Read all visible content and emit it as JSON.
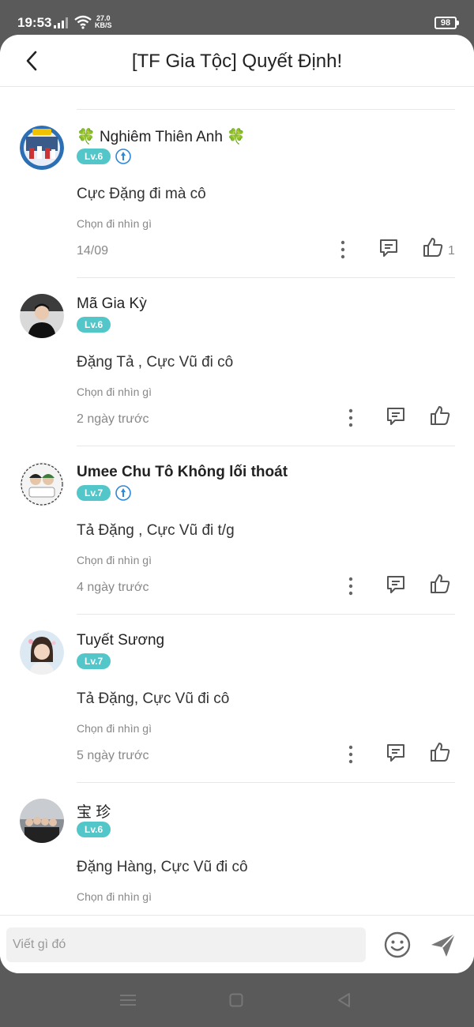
{
  "status_bar": {
    "time": "19:53",
    "net_speed_value": "27.0",
    "net_speed_unit": "KB/S",
    "battery": "98"
  },
  "header": {
    "title": "[TF Gia Tộc] Quyết Định!"
  },
  "colors": {
    "level_badge": "#52c6c9",
    "vip_badge": "#2f87d8",
    "text_primary": "#222222",
    "text_secondary": "#888888"
  },
  "comments": [
    {
      "name": "Nghiêm Thiên Anh",
      "name_prefix": "🍀",
      "name_suffix": "🍀",
      "level": "Lv.6",
      "has_vip": true,
      "text": "Cực Đặng đi mà cô",
      "option": "Chọn đi nhìn gì",
      "time": "14/09",
      "like_count": "1"
    },
    {
      "name": "Mã Gia Kỳ",
      "level": "Lv.6",
      "has_vip": false,
      "text": "Đặng Tả , Cực Vũ đi cô",
      "option": "Chọn đi nhìn gì",
      "time": "2 ngày trước",
      "like_count": ""
    },
    {
      "name": "Umee Chu Tô Không lối thoát",
      "level": "Lv.7",
      "has_vip": true,
      "text": "Tả Đặng , Cực Vũ đi t/g",
      "option": "Chọn đi nhìn gì",
      "time": "4 ngày trước",
      "like_count": ""
    },
    {
      "name": "Tuyết Sương",
      "level": "Lv.7",
      "has_vip": false,
      "text": "Tả Đặng, Cực Vũ đi cô",
      "option": "Chọn đi nhìn gì",
      "time": "5 ngày trước",
      "like_count": ""
    },
    {
      "name": "宝 珍",
      "level": "Lv.6",
      "has_vip": false,
      "text": "Đặng Hàng, Cực Vũ đi cô",
      "option": "Chọn đi nhìn gì",
      "time": "",
      "like_count": ""
    }
  ],
  "input": {
    "placeholder": "Viết gì đó",
    "value": ""
  },
  "icons": {
    "back": "back-arrow-icon",
    "more": "more-vertical-icon",
    "reply": "comment-icon",
    "like": "thumbs-up-icon",
    "emoji": "emoji-icon",
    "send": "send-icon",
    "vip": "vip-badge-icon"
  }
}
